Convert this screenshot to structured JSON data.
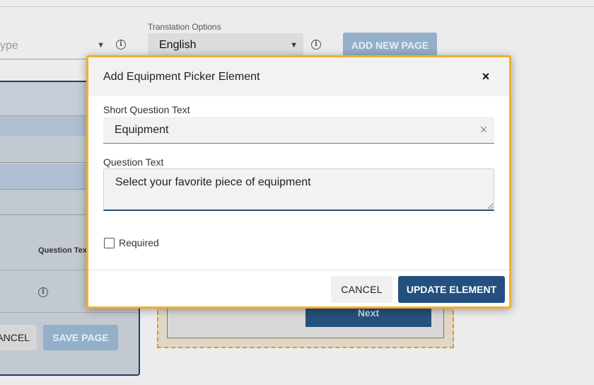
{
  "background": {
    "type_select": {
      "placeholder": "ype"
    },
    "translation": {
      "label": "Translation Options",
      "value": "English"
    },
    "add_page_label": "ADD NEW PAGE",
    "table_header": "Question Tex",
    "cancel_label": "ANCEL",
    "save_label": "SAVE PAGE",
    "preview": {
      "next_label": "Next"
    }
  },
  "modal": {
    "title": "Add Equipment Picker Element",
    "close_symbol": "×",
    "short_question": {
      "label": "Short Question Text",
      "value": "Equipment",
      "clear_symbol": "×"
    },
    "question_text": {
      "label": "Question Text",
      "value": "Select your favorite piece of equipment"
    },
    "required": {
      "label": "Required",
      "checked": false
    },
    "buttons": {
      "cancel": "CANCEL",
      "update": "UPDATE ELEMENT"
    }
  },
  "colors": {
    "accent": "#24507f",
    "modal_border": "#f0b02e",
    "disabled_button": "#94afc9"
  },
  "icons": {
    "info": "info-icon",
    "dropdown": "chevron-down-icon",
    "close": "close-icon",
    "clear": "clear-icon"
  }
}
